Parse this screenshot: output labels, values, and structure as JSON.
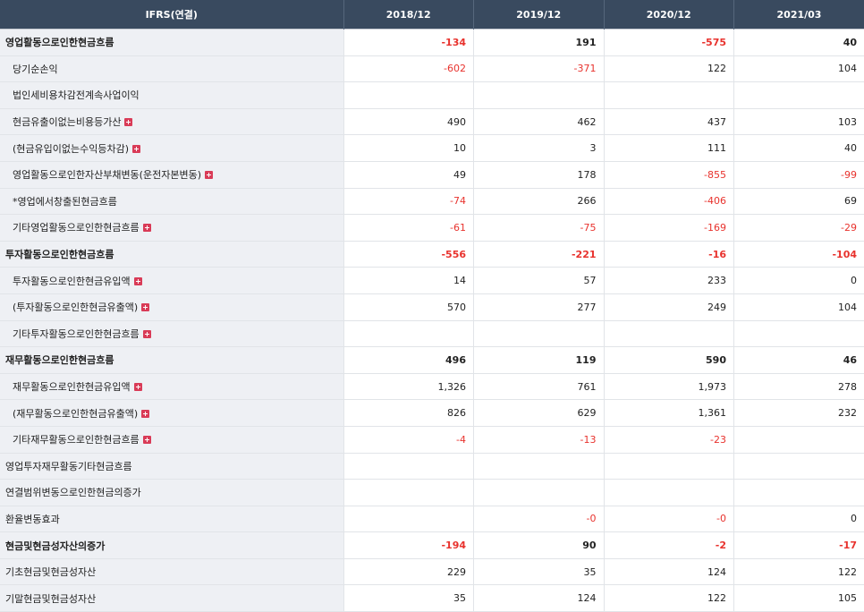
{
  "header": {
    "label": "IFRS(연결)",
    "periods": [
      "2018/12",
      "2019/12",
      "2020/12",
      "2021/03"
    ]
  },
  "rows": [
    {
      "label": "영업활동으로인한현금흐름",
      "level": "major",
      "expand": false,
      "values": [
        "-134",
        "191",
        "-575",
        "40"
      ]
    },
    {
      "label": "당기순손익",
      "level": "sub",
      "expand": false,
      "values": [
        "-602",
        "-371",
        "122",
        "104"
      ]
    },
    {
      "label": "법인세비용차감전계속사업이익",
      "level": "sub",
      "expand": false,
      "values": [
        "",
        "",
        "",
        ""
      ]
    },
    {
      "label": "현금유출이없는비용등가산",
      "level": "sub",
      "expand": true,
      "values": [
        "490",
        "462",
        "437",
        "103"
      ]
    },
    {
      "label": "(현금유입이없는수익등차감)",
      "level": "sub",
      "expand": true,
      "values": [
        "10",
        "3",
        "111",
        "40"
      ]
    },
    {
      "label": "영업활동으로인한자산부채변동(운전자본변동)",
      "level": "sub",
      "expand": true,
      "values": [
        "49",
        "178",
        "-855",
        "-99"
      ]
    },
    {
      "label": "*영업에서창출된현금흐름",
      "level": "sub",
      "expand": false,
      "values": [
        "-74",
        "266",
        "-406",
        "69"
      ]
    },
    {
      "label": "기타영업활동으로인한현금흐름",
      "level": "sub",
      "expand": true,
      "values": [
        "-61",
        "-75",
        "-169",
        "-29"
      ]
    },
    {
      "label": "투자활동으로인한현금흐름",
      "level": "major",
      "expand": false,
      "values": [
        "-556",
        "-221",
        "-16",
        "-104"
      ]
    },
    {
      "label": "투자활동으로인한현금유입액",
      "level": "sub",
      "expand": true,
      "values": [
        "14",
        "57",
        "233",
        "0"
      ]
    },
    {
      "label": "(투자활동으로인한현금유출액)",
      "level": "sub",
      "expand": true,
      "values": [
        "570",
        "277",
        "249",
        "104"
      ]
    },
    {
      "label": "기타투자활동으로인한현금흐름",
      "level": "sub",
      "expand": true,
      "values": [
        "",
        "",
        "",
        ""
      ]
    },
    {
      "label": "재무활동으로인한현금흐름",
      "level": "major",
      "expand": false,
      "values": [
        "496",
        "119",
        "590",
        "46"
      ]
    },
    {
      "label": "재무활동으로인한현금유입액",
      "level": "sub",
      "expand": true,
      "values": [
        "1,326",
        "761",
        "1,973",
        "278"
      ]
    },
    {
      "label": "(재무활동으로인한현금유출액)",
      "level": "sub",
      "expand": true,
      "values": [
        "826",
        "629",
        "1,361",
        "232"
      ]
    },
    {
      "label": "기타재무활동으로인한현금흐름",
      "level": "sub",
      "expand": true,
      "values": [
        "-4",
        "-13",
        "-23",
        ""
      ]
    },
    {
      "label": "영업투자재무활동기타현금흐름",
      "level": "plain",
      "expand": false,
      "values": [
        "",
        "",
        "",
        ""
      ]
    },
    {
      "label": "연결범위변동으로인한현금의증가",
      "level": "plain",
      "expand": false,
      "values": [
        "",
        "",
        "",
        ""
      ]
    },
    {
      "label": "환율변동효과",
      "level": "plain",
      "expand": false,
      "values": [
        "",
        "-0",
        "-0",
        "0"
      ]
    },
    {
      "label": "현금및현금성자산의증가",
      "level": "major",
      "expand": false,
      "values": [
        "-194",
        "90",
        "-2",
        "-17"
      ]
    },
    {
      "label": "기초현금및현금성자산",
      "level": "plain",
      "expand": false,
      "values": [
        "229",
        "35",
        "124",
        "122"
      ]
    },
    {
      "label": "기말현금및현금성자산",
      "level": "plain",
      "expand": false,
      "values": [
        "35",
        "124",
        "122",
        "105"
      ]
    }
  ],
  "colors": {
    "header_bg": "#394a5f",
    "label_bg": "#eef0f4",
    "negative": "#e8322d",
    "expand_icon": "#d93b57"
  },
  "icons": {
    "expand": "plus-icon"
  }
}
